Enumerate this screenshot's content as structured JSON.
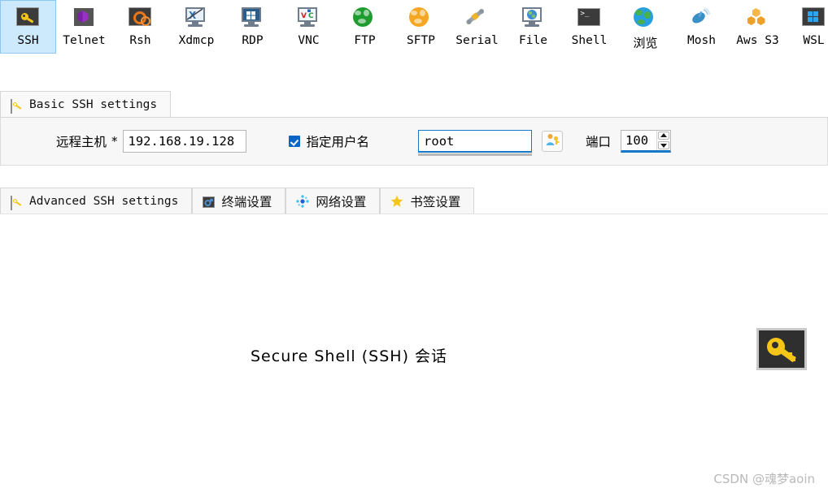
{
  "toolbar": {
    "items": [
      {
        "label": "SSH",
        "icon": "key-icon",
        "selected": true
      },
      {
        "label": "Telnet",
        "icon": "cube-icon",
        "selected": false
      },
      {
        "label": "Rsh",
        "icon": "gears-icon",
        "selected": false
      },
      {
        "label": "Xdmcp",
        "icon": "monitor-x-icon",
        "selected": false
      },
      {
        "label": "RDP",
        "icon": "windows-monitor-icon",
        "selected": false
      },
      {
        "label": "VNC",
        "icon": "vnc-monitor-icon",
        "selected": false
      },
      {
        "label": "FTP",
        "icon": "green-globe-icon",
        "selected": false
      },
      {
        "label": "SFTP",
        "icon": "orange-globe-icon",
        "selected": false
      },
      {
        "label": "Serial",
        "icon": "plug-icon",
        "selected": false
      },
      {
        "label": "File",
        "icon": "file-monitor-icon",
        "selected": false
      },
      {
        "label": "Shell",
        "icon": "terminal-icon",
        "selected": false
      },
      {
        "label": "浏览",
        "icon": "browse-globe-icon",
        "selected": false
      },
      {
        "label": "Mosh",
        "icon": "satellite-icon",
        "selected": false
      },
      {
        "label": "Aws S3",
        "icon": "aws-cubes-icon",
        "selected": false
      },
      {
        "label": "WSL",
        "icon": "wsl-windows-icon",
        "selected": false
      }
    ]
  },
  "top_tabs": [
    {
      "label": "Basic SSH settings",
      "icon": "key-icon",
      "active": true
    }
  ],
  "form": {
    "host_label": "远程主机",
    "host_required_marker": "*",
    "host_value": "192.168.19.128",
    "username_checkbox_label": "指定用户名",
    "username_checked": true,
    "username_value": "root",
    "username_button_icon": "user-key-icon",
    "port_label": "端口",
    "port_value": "100",
    "spinner_up_icon": "arrow-up-icon",
    "spinner_down_icon": "arrow-down-icon"
  },
  "lower_tabs": [
    {
      "label": "Advanced SSH settings",
      "icon": "key-icon"
    },
    {
      "label": "终端设置",
      "icon": "terminal-gear-icon"
    },
    {
      "label": "网络设置",
      "icon": "network-dots-icon"
    },
    {
      "label": "书签设置",
      "icon": "star-icon"
    }
  ],
  "content": {
    "title": "Secure Shell (SSH) 会话",
    "badge_icon": "big-key-icon"
  },
  "watermark": "CSDN @魂梦aoin",
  "colors": {
    "selection_blue": "#cdeafd",
    "selection_border": "#8ec7ef",
    "focus_blue": "#1878c8",
    "checkbox_blue": "#0a65c8",
    "key_yellow": "#f5c518",
    "panel_gray": "#f7f7f7"
  }
}
